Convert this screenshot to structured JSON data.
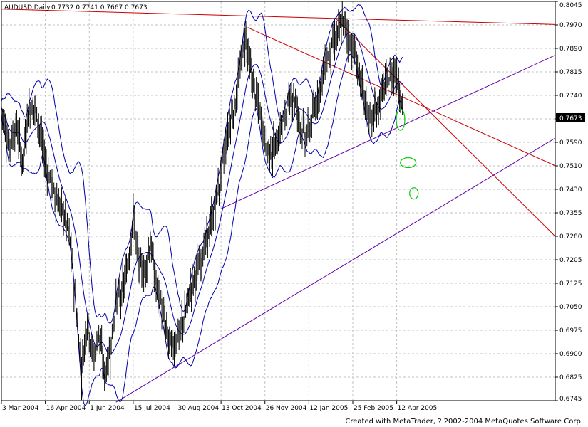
{
  "header": {
    "symbol_label": "AUDUSD,Daily",
    "ohlc_label": "0.7732 0.7741 0.7667 0.7673"
  },
  "footer": {
    "credit": "Created with MetaTrader, ? 2002-2004 MetaQuotes Software Corp."
  },
  "chart_data": {
    "type": "ohlc",
    "symbol": "AUDUSD",
    "timeframe": "Daily",
    "current_price": "0.7673",
    "grid": true,
    "colors": {
      "bars": "#000000",
      "bollinger": "#0000aa",
      "red_lines": "#cc0000",
      "purple_lines": "#6600aa",
      "green_marks": "#00cc00",
      "grid": "#c0c0c0",
      "price_tag_bg": "#000000"
    },
    "ylim": [
      0.6745,
      0.8045
    ],
    "xlim": [
      0,
      580
    ],
    "y_ticks": [
      "0.8045",
      "0.7970",
      "0.7890",
      "0.7815",
      "0.7740",
      "0.7665",
      "0.7590",
      "0.7510",
      "0.7430",
      "0.7355",
      "0.7280",
      "0.7205",
      "0.7125",
      "0.7050",
      "0.6975",
      "0.6900",
      "0.6825",
      "0.6745"
    ],
    "x_ticks": [
      {
        "x": 0,
        "label": "3 Mar 2004"
      },
      {
        "x": 46,
        "label": "16 Apr 2004"
      },
      {
        "x": 92,
        "label": "1 Jun 2004"
      },
      {
        "x": 138,
        "label": "15 Jul 2004"
      },
      {
        "x": 184,
        "label": "30 Aug 2004"
      },
      {
        "x": 230,
        "label": "13 Oct 2004"
      },
      {
        "x": 276,
        "label": "26 Nov 2004"
      },
      {
        "x": 322,
        "label": "12 Jan 2005"
      },
      {
        "x": 368,
        "label": "25 Feb 2005"
      },
      {
        "x": 414,
        "label": "12 Apr 2005"
      }
    ],
    "price_anchors": [
      [
        0,
        0.77
      ],
      [
        8,
        0.757
      ],
      [
        16,
        0.764
      ],
      [
        22,
        0.752
      ],
      [
        28,
        0.769
      ],
      [
        36,
        0.77
      ],
      [
        46,
        0.752
      ],
      [
        56,
        0.741
      ],
      [
        66,
        0.735
      ],
      [
        72,
        0.726
      ],
      [
        78,
        0.705
      ],
      [
        84,
        0.685
      ],
      [
        90,
        0.701
      ],
      [
        96,
        0.688
      ],
      [
        102,
        0.697
      ],
      [
        108,
        0.683
      ],
      [
        114,
        0.691
      ],
      [
        120,
        0.707
      ],
      [
        126,
        0.709
      ],
      [
        132,
        0.718
      ],
      [
        138,
        0.735
      ],
      [
        144,
        0.718
      ],
      [
        150,
        0.716
      ],
      [
        156,
        0.726
      ],
      [
        162,
        0.712
      ],
      [
        168,
        0.705
      ],
      [
        174,
        0.695
      ],
      [
        180,
        0.692
      ],
      [
        186,
        0.697
      ],
      [
        192,
        0.702
      ],
      [
        198,
        0.711
      ],
      [
        204,
        0.716
      ],
      [
        210,
        0.721
      ],
      [
        216,
        0.728
      ],
      [
        222,
        0.735
      ],
      [
        228,
        0.745
      ],
      [
        234,
        0.756
      ],
      [
        240,
        0.766
      ],
      [
        246,
        0.773
      ],
      [
        252,
        0.787
      ],
      [
        256,
        0.794
      ],
      [
        260,
        0.784
      ],
      [
        264,
        0.777
      ],
      [
        270,
        0.769
      ],
      [
        276,
        0.76
      ],
      [
        282,
        0.755
      ],
      [
        288,
        0.758
      ],
      [
        294,
        0.765
      ],
      [
        300,
        0.77
      ],
      [
        306,
        0.774
      ],
      [
        312,
        0.766
      ],
      [
        318,
        0.76
      ],
      [
        324,
        0.764
      ],
      [
        330,
        0.772
      ],
      [
        336,
        0.78
      ],
      [
        342,
        0.787
      ],
      [
        348,
        0.791
      ],
      [
        354,
        0.795
      ],
      [
        358,
        0.798
      ],
      [
        364,
        0.792
      ],
      [
        370,
        0.788
      ],
      [
        376,
        0.778
      ],
      [
        382,
        0.77
      ],
      [
        388,
        0.766
      ],
      [
        394,
        0.77
      ],
      [
        400,
        0.776
      ],
      [
        406,
        0.779
      ],
      [
        412,
        0.782
      ],
      [
        416,
        0.778
      ],
      [
        420,
        0.77
      ]
    ],
    "red_lines": [
      [
        [
          0,
          0.802
        ],
        [
          580,
          0.797
        ]
      ],
      [
        [
          258,
          0.796
        ],
        [
          580,
          0.751
        ]
      ],
      [
        [
          350,
          0.799
        ],
        [
          580,
          0.728
        ]
      ]
    ],
    "purple_lines": [
      [
        [
          230,
          0.737
        ],
        [
          580,
          0.787
        ]
      ],
      [
        [
          120,
          0.674
        ],
        [
          580,
          0.76
        ]
      ]
    ],
    "green_marks": [
      {
        "x": 418,
        "y": 0.766,
        "rx": 6,
        "ry": 15
      },
      {
        "x": 426,
        "y": 0.752,
        "rx": 11,
        "ry": 7
      },
      {
        "x": 432,
        "y": 0.742,
        "rx": 6,
        "ry": 8
      }
    ]
  }
}
